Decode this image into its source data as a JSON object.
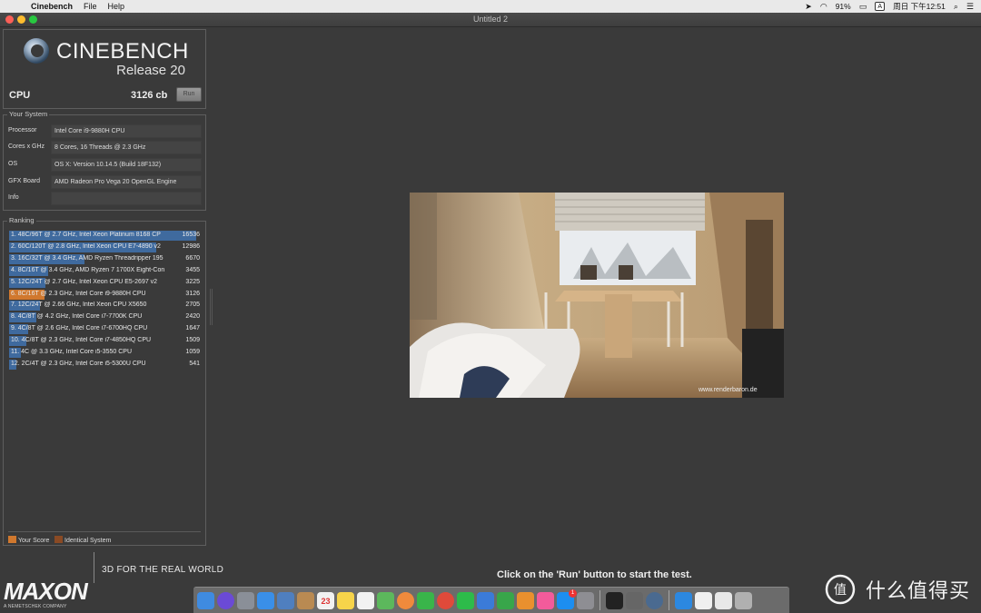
{
  "menubar": {
    "app_name": "Cinebench",
    "menus": [
      "File",
      "Help"
    ],
    "battery": "91%",
    "input_method": "A",
    "clock": "周日 下午12:51"
  },
  "window": {
    "title": "Untitled 2"
  },
  "header": {
    "product": "CINEBENCH",
    "release": "Release 20",
    "cpu_label": "CPU",
    "cpu_score": "3126 cb",
    "run_label": "Run"
  },
  "system": {
    "legend": "Your System",
    "rows": [
      {
        "key": "Processor",
        "value": "Intel Core i9-9880H CPU"
      },
      {
        "key": "Cores x GHz",
        "value": "8 Cores, 16 Threads @ 2.3 GHz"
      },
      {
        "key": "OS",
        "value": "OS X: Version 10.14.5 (Build 18F132)"
      },
      {
        "key": "GFX Board",
        "value": "AMD Radeon Pro Vega 20 OpenGL Engine"
      },
      {
        "key": "Info",
        "value": ""
      }
    ]
  },
  "ranking": {
    "legend": "Ranking",
    "rows": [
      {
        "label": "1. 48C/96T @ 2.7 GHz, Intel Xeon Platinum 8168 CP",
        "score": "16536",
        "value": 16536,
        "mine": false
      },
      {
        "label": "2. 60C/120T @ 2.8 GHz, Intel Xeon CPU E7-4890 v2",
        "score": "12986",
        "value": 12986,
        "mine": false
      },
      {
        "label": "3. 16C/32T @ 3.4 GHz, AMD Ryzen Threadripper 195",
        "score": "6670",
        "value": 6670,
        "mine": false
      },
      {
        "label": "4. 8C/16T @ 3.4 GHz, AMD Ryzen 7 1700X Eight-Con",
        "score": "3455",
        "value": 3455,
        "mine": false
      },
      {
        "label": "5. 12C/24T @ 2.7 GHz, Intel Xeon CPU E5-2697 v2",
        "score": "3225",
        "value": 3225,
        "mine": false
      },
      {
        "label": "6. 8C/16T @ 2.3 GHz, Intel Core i9-9880H CPU",
        "score": "3126",
        "value": 3126,
        "mine": true
      },
      {
        "label": "7. 12C/24T @ 2.66 GHz, Intel Xeon CPU X5650",
        "score": "2705",
        "value": 2705,
        "mine": false
      },
      {
        "label": "8. 4C/8T @ 4.2 GHz, Intel Core i7-7700K CPU",
        "score": "2420",
        "value": 2420,
        "mine": false
      },
      {
        "label": "9. 4C/8T @ 2.6 GHz, Intel Core i7-6700HQ CPU",
        "score": "1647",
        "value": 1647,
        "mine": false
      },
      {
        "label": "10. 4C/8T @ 2.3 GHz, Intel Core i7-4850HQ CPU",
        "score": "1509",
        "value": 1509,
        "mine": false
      },
      {
        "label": "11. 4C @ 3.3 GHz, Intel Core i5-3550 CPU",
        "score": "1059",
        "value": 1059,
        "mine": false
      },
      {
        "label": "12. 2C/4T @ 2.3 GHz, Intel Core i5-5300U CPU",
        "score": "541",
        "value": 541,
        "mine": false
      }
    ],
    "legend_your_score": "Your Score",
    "legend_identical": "Identical System",
    "colors": {
      "bar": "#3f6a9e",
      "your_score": "#d0782e",
      "identical": "#8a4a24"
    }
  },
  "footer": {
    "maxon": "MAXON",
    "maxon_sub": "A NEMETSCHEK COMPANY",
    "tagline": "3D FOR THE REAL WORLD"
  },
  "render": {
    "watermark": "www.renderbaron.de"
  },
  "status": "Click on the 'Run' button to start the test.",
  "dock": {
    "icons": [
      "finder-icon",
      "siri-icon",
      "launchpad-icon",
      "safari-icon",
      "preview-icon",
      "contacts-icon",
      "calendar-icon",
      "notes-icon",
      "reminders-icon",
      "maps-icon",
      "photos-icon",
      "messages-icon",
      "chrome-icon",
      "wechat-icon",
      "keynote-icon",
      "numbers-icon",
      "pages-icon",
      "itunes-icon",
      "app-store-icon",
      "system-preferences-icon",
      "terminal-icon",
      "airdrop-icon",
      "cinebench-dock-icon",
      "downloads-icon",
      "document-icon",
      "image-icon",
      "trash-icon"
    ],
    "calendar_date": "23",
    "appstore_badge": "1"
  },
  "watermark": {
    "text": "什么值得买"
  }
}
